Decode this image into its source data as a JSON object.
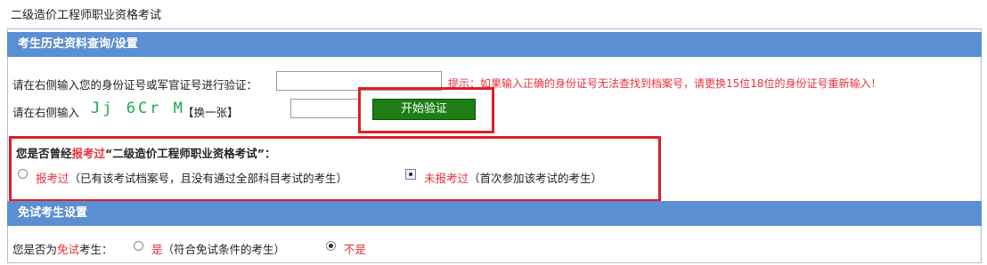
{
  "page": {
    "title": "二级造价工程师职业资格考试"
  },
  "history": {
    "section_title": "考生历史资料查询/设置",
    "id_prompt": "请在右侧输入您的身份证号或军官证号进行验证：",
    "id_value": "",
    "hint": "提示：如果输入正确的身份证号无法查找到档案号，请更换15位18位的身份证号重新输入！",
    "captcha_prompt": "请在右侧输入",
    "captcha_text": "Jj 6Cr M",
    "refresh_link": "【换一张】",
    "captcha_value": "",
    "start_button": "开始验证"
  },
  "exam_type": {
    "question_prefix": "您是否曾经",
    "question_emph": "报考过",
    "question_suffix": "“二级造价工程师职业资格考试”：",
    "option_old_label": "报考过",
    "option_old_desc": "（已有该考试档案号，且没有通过全部科目考试的考生）",
    "option_new_label": "未报考过",
    "option_new_desc": "（首次参加该考试的考生）",
    "selected": "new"
  },
  "exemption": {
    "section_title": "免试考生设置",
    "question_prefix": "您是否为",
    "question_emph": "免试",
    "question_suffix": "考生：",
    "option_yes_label": "是",
    "option_yes_desc": "（符合免试条件的考生）",
    "option_no_label": "不是",
    "selected": "no"
  },
  "colors": {
    "section_bar": "#5b8fd3",
    "accent_red": "#e8303a",
    "button_green": "#1e7e16",
    "highlight_box": "#e01d25"
  }
}
